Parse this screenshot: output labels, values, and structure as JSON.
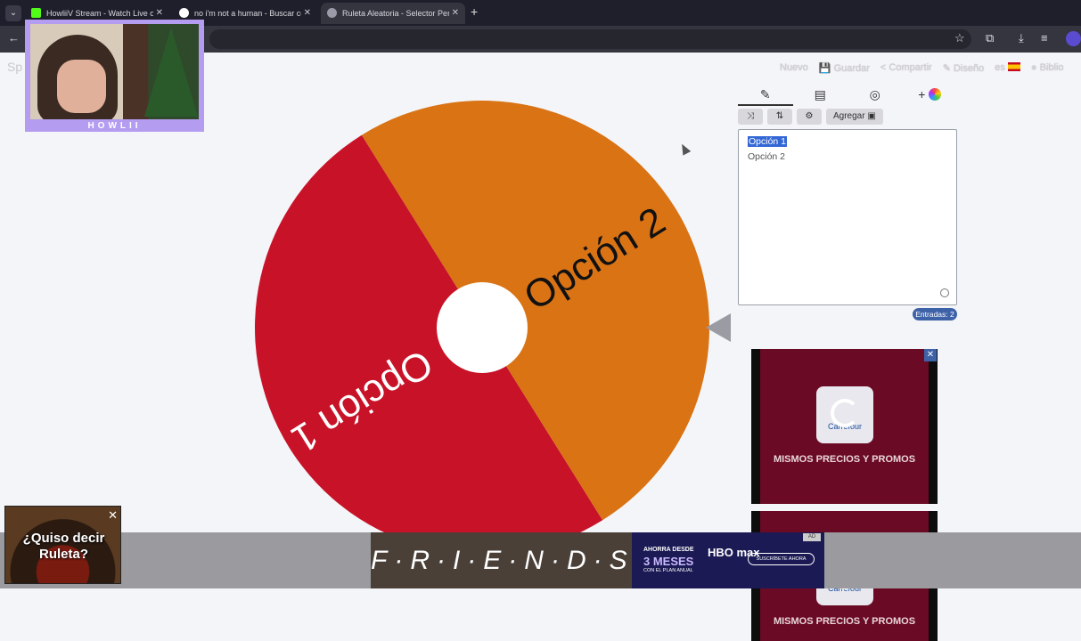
{
  "browser": {
    "tabs": [
      {
        "title": "HowliiV Stream - Watch Live on",
        "favicon_color": "#53fc18"
      },
      {
        "title": "no i'm not a human - Buscar co",
        "favicon_color": "#ffffff"
      },
      {
        "title": "Ruleta Aleatoria - Selector Pers",
        "favicon_color": "#9a9aa8"
      }
    ],
    "new_tab": "+",
    "back": "←"
  },
  "site": {
    "brand": "Sp",
    "menu": [
      "Nuevo",
      "Guardar",
      "Compartir",
      "Diseño",
      "es",
      "Biblio"
    ]
  },
  "wheel": {
    "segments": [
      {
        "label": "Opción 1",
        "color": "#c81228"
      },
      {
        "label": "Opción 2",
        "color": "#d97314"
      }
    ]
  },
  "editor": {
    "tabs": [
      "pencil-icon",
      "clipboard-icon",
      "eye-slash-icon",
      "palette-icon"
    ],
    "tab_plus": "+",
    "buttons": {
      "shuffle": "⤨",
      "sort": "⇅",
      "settings": "⚙",
      "add": "Agregar ▣"
    },
    "entries": [
      "Opción 1",
      "Opción 2"
    ],
    "count_label": "Entradas: 2"
  },
  "ads": {
    "right_card_logo": "Carrefour",
    "right_card_text": "MISMOS PRECIOS Y PROMOS",
    "close": "✕",
    "friends_title": "F·R·I·E·N·D·S",
    "hbo": {
      "line1": "AHORRA DESDE",
      "line2": "3 MESES",
      "line3": "CON EL PLAN ANUAL",
      "brand": "HBO max",
      "cta": "SUSCRÍBETE AHORA",
      "tag": "AD"
    },
    "promo_text": "¿Quiso decir Ruleta?",
    "promo_close": "✕"
  },
  "webcam": {
    "name": "HOWLII"
  }
}
